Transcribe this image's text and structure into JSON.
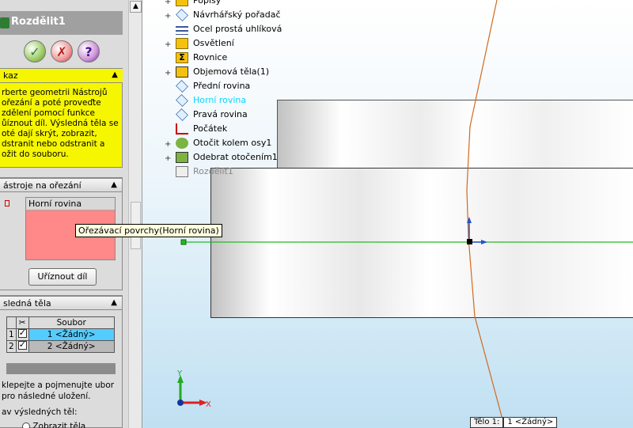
{
  "property_manager": {
    "title": "Rozdělit1",
    "buttons": {
      "ok": "✓",
      "cancel": "✗",
      "help": "?"
    },
    "message": {
      "header": "kaz",
      "text": "rberte geometrii Nástrojů ořezání a poté proveďte zdělení pomocí funkce ůíznout díl. Výsledná těla se oté dají skrýt, zobrazit, dstranit nebo odstranit a ožit do souboru."
    },
    "tools": {
      "header": "ástroje na ořezání",
      "list": [
        "Horní rovina"
      ],
      "cut_button": "Uříznout díl"
    },
    "results": {
      "header": "sledná těla",
      "column_header": "Soubor",
      "rows": [
        {
          "index": "1",
          "value": "1 <Žádný>"
        },
        {
          "index": "2",
          "value": "2 <Žádný>"
        }
      ],
      "note": "klepejte a pojmenujte ubor pro následné uložení.",
      "show_label": "av výsledných těl:",
      "radio_label": "Zobrazit těla"
    }
  },
  "feature_tree": [
    {
      "label": "Popisy",
      "icon": "annotations-icon",
      "expandable": true
    },
    {
      "label": "Návrhářský pořadač",
      "icon": "design-binder-icon",
      "expandable": true
    },
    {
      "label": "Ocel prostá uhlíková",
      "icon": "material-icon",
      "expandable": false
    },
    {
      "label": "Osvětlení",
      "icon": "lighting-folder-icon",
      "expandable": true
    },
    {
      "label": "Rovnice",
      "icon": "equations-icon",
      "expandable": false
    },
    {
      "label": "Objemová těla(1)",
      "icon": "solid-bodies-icon",
      "expandable": true
    },
    {
      "label": "Přední rovina",
      "icon": "plane-icon",
      "expandable": false
    },
    {
      "label": "Horní rovina",
      "icon": "plane-icon",
      "expandable": false,
      "selected": true
    },
    {
      "label": "Pravá rovina",
      "icon": "plane-icon",
      "expandable": false
    },
    {
      "label": "Počátek",
      "icon": "origin-icon",
      "expandable": false
    },
    {
      "label": "Otočit kolem osy1",
      "icon": "revolve-icon",
      "expandable": true
    },
    {
      "label": "Odebrat otočením1",
      "icon": "cut-revolve-icon",
      "expandable": true
    },
    {
      "label": "Rozdělit1",
      "icon": "split-icon",
      "expandable": false,
      "faded": true
    }
  ],
  "tooltip": "Ořezávací povrchy(Horní rovina)",
  "status": {
    "label": "Tělo 1:",
    "value": "1 <Žádný>"
  },
  "axes": {
    "x": "X",
    "y": "Y"
  },
  "colors": {
    "message_bg": "#f6f600",
    "tool_list_bg": "#ff8888",
    "selected_row": "#55ccff",
    "plane_line": "#22bb22",
    "split_line": "#d2691e"
  }
}
